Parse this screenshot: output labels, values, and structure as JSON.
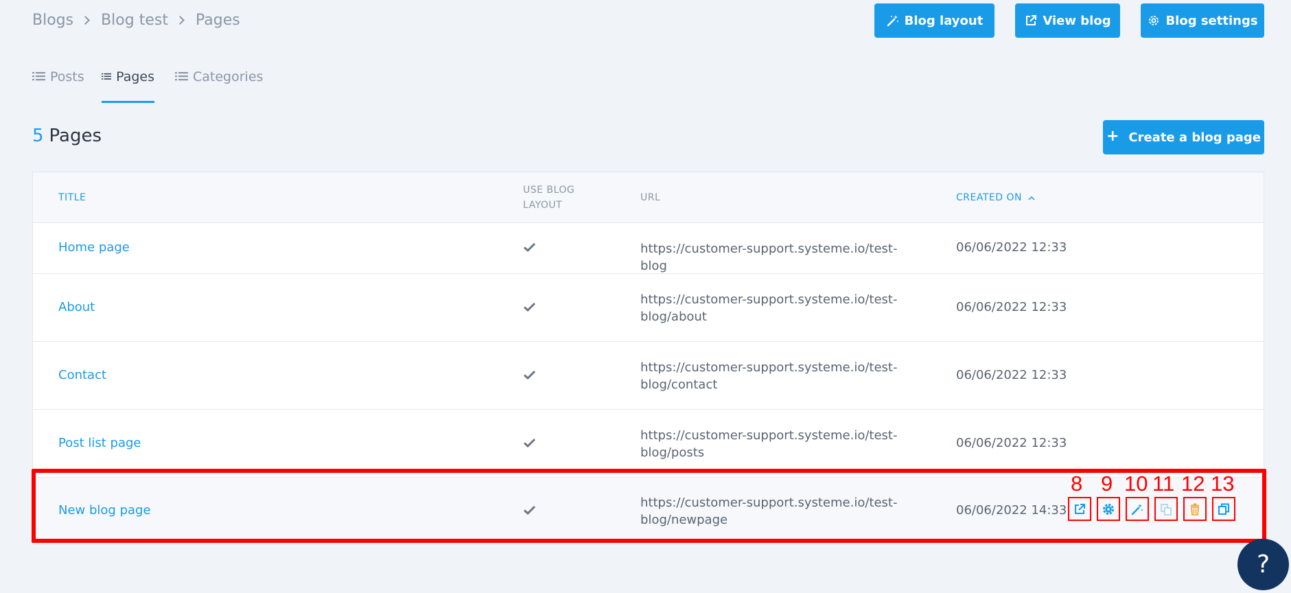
{
  "breadcrumb": [
    "Blogs",
    "Blog test",
    "Pages"
  ],
  "toolbar": {
    "blog_layout": "Blog layout",
    "view_blog": "View blog",
    "blog_settings": "Blog settings"
  },
  "tabs": [
    {
      "label": "Posts",
      "active": false
    },
    {
      "label": "Pages",
      "active": true
    },
    {
      "label": "Categories",
      "active": false
    }
  ],
  "heading": {
    "count": "5",
    "label": "Pages"
  },
  "create_button": "Create a blog page",
  "table": {
    "columns": {
      "title": "TITLE",
      "use_blog_layout_1": "USE BLOG",
      "use_blog_layout_2": "LAYOUT",
      "url": "URL",
      "created_on": "CREATED ON"
    },
    "rows": [
      {
        "title": "Home page",
        "url_1": "https://customer-support.systeme.io/test-blog",
        "url_2": "",
        "created": "06/06/2022 12:33"
      },
      {
        "title": "About",
        "url_1": "https://customer-support.systeme.io/test-",
        "url_2": "blog/about",
        "created": "06/06/2022 12:33"
      },
      {
        "title": "Contact",
        "url_1": "https://customer-support.systeme.io/test-",
        "url_2": "blog/contact",
        "created": "06/06/2022 12:33"
      },
      {
        "title": "Post list page",
        "url_1": "https://customer-support.systeme.io/test-",
        "url_2": "blog/posts",
        "created": "06/06/2022 12:33"
      },
      {
        "title": "New blog page",
        "url_1": "https://customer-support.systeme.io/test-",
        "url_2": "blog/newpage",
        "created": "06/06/2022 14:33"
      }
    ]
  },
  "action_markers": [
    "8",
    "9",
    "10",
    "11",
    "12",
    "13"
  ],
  "action_icons": [
    "external-link-icon",
    "gear-icon",
    "magic-wand-icon",
    "copy-icon",
    "trash-icon",
    "duplicate-icon"
  ],
  "colors": {
    "accent": "#1a9be8",
    "highlight": "#ff0000",
    "delete": "#f5a623",
    "help_bg": "#13345f"
  },
  "help_label": "?"
}
